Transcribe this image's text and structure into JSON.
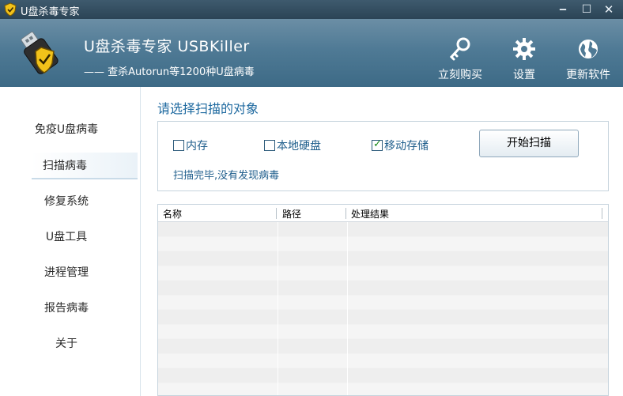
{
  "window": {
    "title": "U盘杀毒专家",
    "controls": {
      "minimize": "‒",
      "maximize": "☐",
      "close": "✕"
    }
  },
  "header": {
    "app_name": "U盘杀毒专家  USBKiller",
    "tagline": "—— 查杀Autorun等1200种U盘病毒",
    "buttons": [
      {
        "label": "立刻购买",
        "icon": "key-icon"
      },
      {
        "label": "设置",
        "icon": "gear-icon"
      },
      {
        "label": "更新软件",
        "icon": "globe-icon"
      }
    ]
  },
  "sidebar": {
    "items": [
      {
        "label": "免疫U盘病毒",
        "active": false
      },
      {
        "label": "扫描病毒",
        "active": true
      },
      {
        "label": "修复系统",
        "active": false
      },
      {
        "label": "U盘工具",
        "active": false
      },
      {
        "label": "进程管理",
        "active": false
      },
      {
        "label": "报告病毒",
        "active": false
      },
      {
        "label": "关于",
        "active": false
      }
    ]
  },
  "scan": {
    "section_title": "请选择扫描的对象",
    "options": [
      {
        "label": "内存",
        "checked": false
      },
      {
        "label": "本地硬盘",
        "checked": false
      },
      {
        "label": "移动存储",
        "checked": true
      }
    ],
    "start_button": "开始扫描",
    "status": "扫描完毕,没有发现病毒"
  },
  "results": {
    "columns": [
      "名称",
      "路径",
      "处理结果"
    ],
    "rows": []
  },
  "colors": {
    "header_bg": "#4f7a95",
    "titlebar_bg": "#2b4456",
    "accent_text": "#1f6aa0"
  }
}
